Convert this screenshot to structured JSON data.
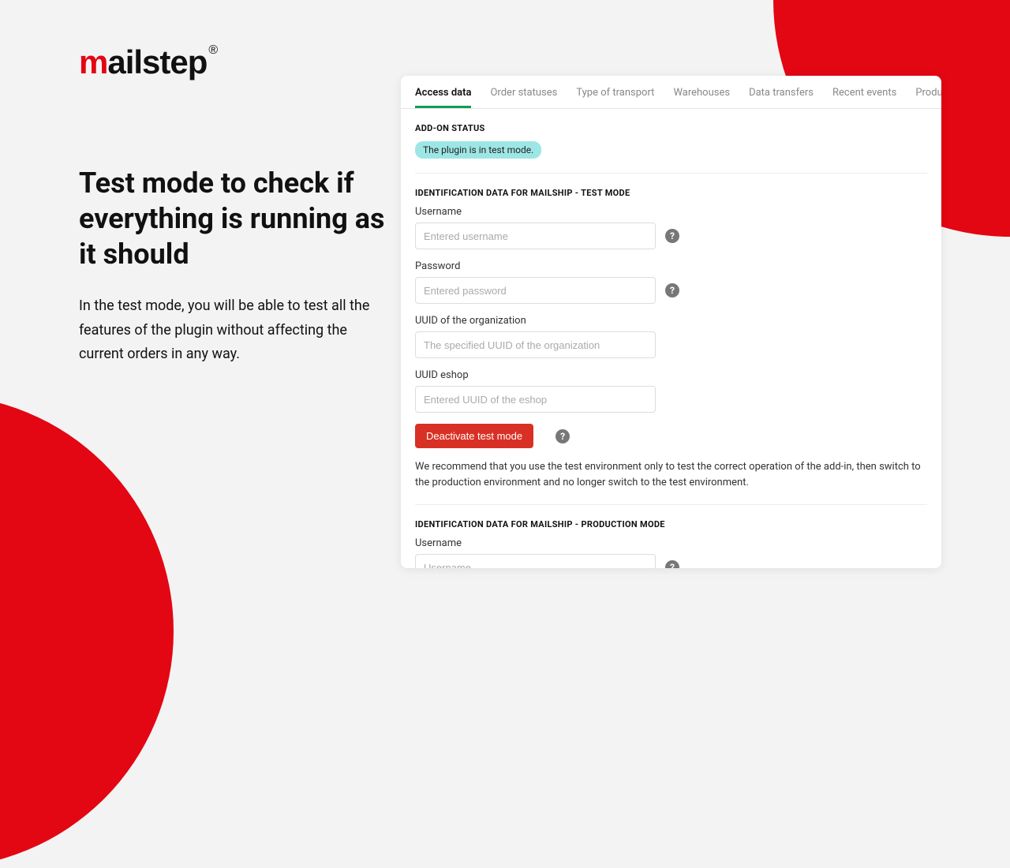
{
  "logo": {
    "prefix": "m",
    "suffix": "ailstep",
    "reg": "®"
  },
  "hero": {
    "title": "Test mode to check if everything is running as it should",
    "body": "In the test mode, you will be able to test all the features of the plugin without affecting the current orders in any way."
  },
  "tabs": {
    "access_data": "Access data",
    "order_statuses": "Order statuses",
    "transport": "Type of transport",
    "warehouses": "Warehouses",
    "data_transfers": "Data transfers",
    "recent_events": "Recent events",
    "products": "Products"
  },
  "addon": {
    "title": "ADD-ON STATUS",
    "badge": "The plugin is in test mode."
  },
  "test_section": {
    "title": "IDENTIFICATION DATA FOR MAILSHIP - TEST MODE",
    "username_label": "Username",
    "username_ph": "Entered username",
    "password_label": "Password",
    "password_ph": "Entered password",
    "org_label": "UUID of the organization",
    "org_ph": "The specified UUID of the organization",
    "eshop_label": "UUID eshop",
    "eshop_ph": "Entered UUID of the eshop",
    "deactivate": "Deactivate test mode",
    "hint": "We recommend that you use the test environment only to test the correct operation of the add-in, then switch to the production environment and no longer switch to the test environment."
  },
  "prod_section": {
    "title": "IDENTIFICATION DATA FOR MAILSHIP - PRODUCTION MODE",
    "username_label": "Username",
    "username_ph": "Username"
  }
}
